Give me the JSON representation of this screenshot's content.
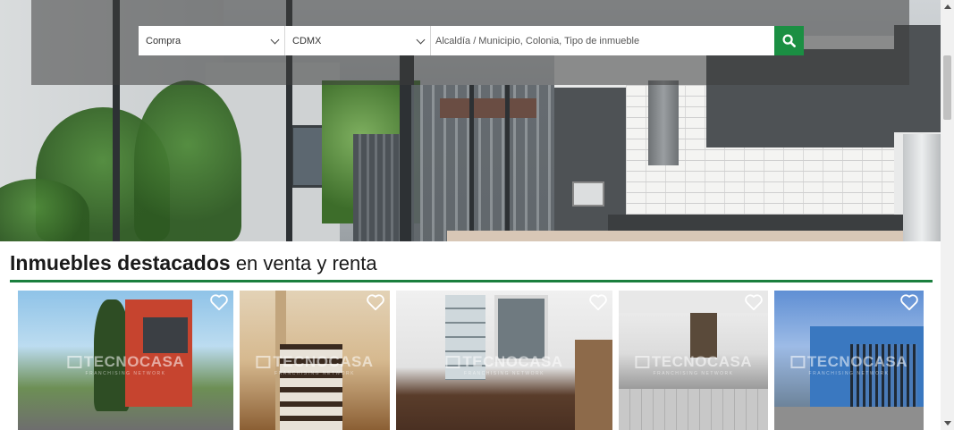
{
  "search": {
    "operation_value": "Compra",
    "city_value": "CDMX",
    "location_placeholder": "Alcaldía / Municipio, Colonia, Tipo de inmueble",
    "button_icon": "search-icon"
  },
  "featured": {
    "title_strong": "Inmuebles destacados",
    "title_rest": " en venta y renta",
    "cards": [
      {
        "favorite_icon": "heart-outline-icon",
        "watermark": "TECNOCASA",
        "watermark_sub": "FRANCHISING NETWORK"
      },
      {
        "favorite_icon": "heart-outline-icon",
        "watermark": "TECNOCASA",
        "watermark_sub": "FRANCHISING NETWORK"
      },
      {
        "favorite_icon": "heart-outline-icon",
        "watermark": "TECNOCASA",
        "watermark_sub": "FRANCHISING NETWORK"
      },
      {
        "favorite_icon": "heart-outline-icon",
        "watermark": "TECNOCASA",
        "watermark_sub": "FRANCHISING NETWORK"
      },
      {
        "favorite_icon": "heart-outline-icon",
        "watermark": "TECNOCASA",
        "watermark_sub": "FRANCHISING NETWORK"
      }
    ]
  },
  "colors": {
    "accent_green": "#1b8f43",
    "rule_green": "#1b7f3e"
  }
}
